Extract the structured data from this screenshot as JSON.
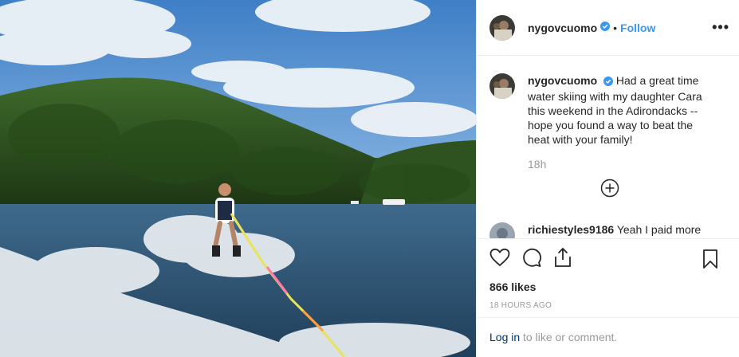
{
  "post": {
    "image_alt": "Man water skiing on a lake with forested hills",
    "colors": {
      "accent": "#3897f0",
      "verified": "#3897f0",
      "muted": "#999999",
      "link": "#003569"
    }
  },
  "header": {
    "username": "nygovcuomo",
    "separator": "•",
    "follow_label": "Follow",
    "more_icon": "more-options-icon"
  },
  "caption": {
    "username": "nygovcuomo",
    "text": "Had a great time water skiing with my daughter Cara this weekend in the Adirondacks -- hope you found a way to beat the heat with your family!",
    "time": "18h"
  },
  "comments": [
    {
      "username": "richiestyles9186",
      "text": "Yeah I paid more"
    }
  ],
  "actions": {
    "like_icon": "heart-icon",
    "comment_icon": "comment-icon",
    "share_icon": "share-icon",
    "save_icon": "bookmark-icon"
  },
  "likes": "866 likes",
  "timestamp": "18 HOURS AGO",
  "login": {
    "link": "Log in",
    "rest": " to like or comment."
  }
}
